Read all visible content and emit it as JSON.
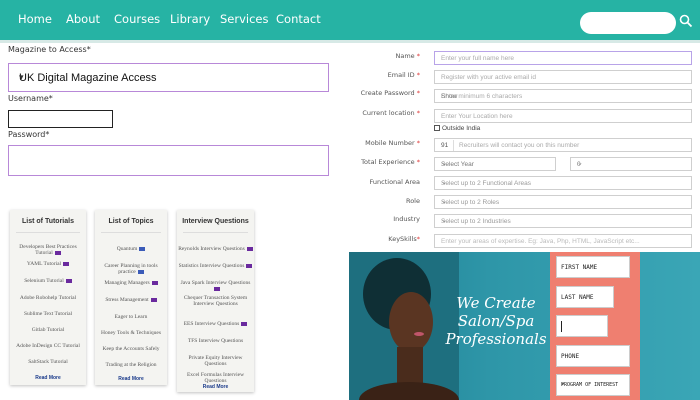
{
  "nav": {
    "items": [
      "Home",
      "About",
      "Courses",
      "Library",
      "Services",
      "Contact"
    ],
    "search_placeholder": ""
  },
  "left_form": {
    "magazine_label": "Magazine to Access",
    "magazine_required": "*",
    "magazine_value": "UK Digital Magazine Access",
    "username_label": "Username*",
    "username_value": "",
    "password_label": "Password*",
    "password_value": ""
  },
  "cards": [
    {
      "title": "List of Tutorials",
      "items": [
        "Developers Best Practices Tutorial",
        "YAML Tutorial",
        "Selenium Tutorial",
        "Adobe Robohelp Tutorial",
        "Sublime Text Tutorial",
        "Gitlab Tutorial",
        "Adobe InDesign CC Tutorial",
        "SaltStack Tutorial"
      ],
      "read_more": "Read More"
    },
    {
      "title": "List of Topics",
      "items": [
        "Quantum",
        "Career Planning in tools practice",
        "Managing Managers",
        "Stress Management",
        "Eager to Learn",
        "Honey Tools & Techniques",
        "Keep the Accounts Safely",
        "Trading at the Religion"
      ],
      "read_more": "Read More"
    },
    {
      "title": "Interview Questions",
      "items": [
        "Reynolds Interview Questions",
        "Statistics Interview Questions",
        "Java Spark Interview Questions",
        "Chequer Transaction System Interview Questions",
        "EES Interview Questions",
        "TFS Interview Questions",
        "Private Equity Interview Questions",
        "Excel Formulas Interview Questions"
      ],
      "read_more": "Read More"
    }
  ],
  "right_form": {
    "name_label": "Name",
    "name_placeholder": "Enter your full name here",
    "email_label": "Email ID",
    "email_placeholder": "Register with your active email id",
    "password_label": "Create Password",
    "password_placeholder": "Enter minimum 6 characters",
    "password_show": "Show",
    "location_label": "Current location",
    "location_placeholder": "Enter Your Location here",
    "outside_india": "Outside India",
    "mobile_label": "Mobile Number",
    "mobile_code": "91",
    "mobile_placeholder": "Recruiters will contact you on this number",
    "experience_label": "Total Experience",
    "experience_year": "Select Year",
    "experience_month": "0",
    "functional_label": "Functional Area",
    "functional_placeholder": "Select up to 2 Functional Areas",
    "role_label": "Role",
    "role_placeholder": "Select up to 2 Roles",
    "industry_label": "Industry",
    "industry_placeholder": "Select up to 2 Industries",
    "keyskills_label": "KeySkills",
    "keyskills_placeholder": "Enter your areas of expertise. Eg: Java, Php, HTML, JavaScript etc..."
  },
  "banner": {
    "headline": [
      "We Create",
      "Salon/Spa",
      "Professionals"
    ],
    "fields": [
      "FIRST NAME",
      "LAST NAME",
      "",
      "PHONE",
      "PROGRAM OF INTEREST"
    ]
  },
  "colors": {
    "nav_bg": "#26b3a4",
    "banner_teal": "#2e96a8",
    "banner_panel": "#ef7f70",
    "focus_border": "#b888d8"
  }
}
